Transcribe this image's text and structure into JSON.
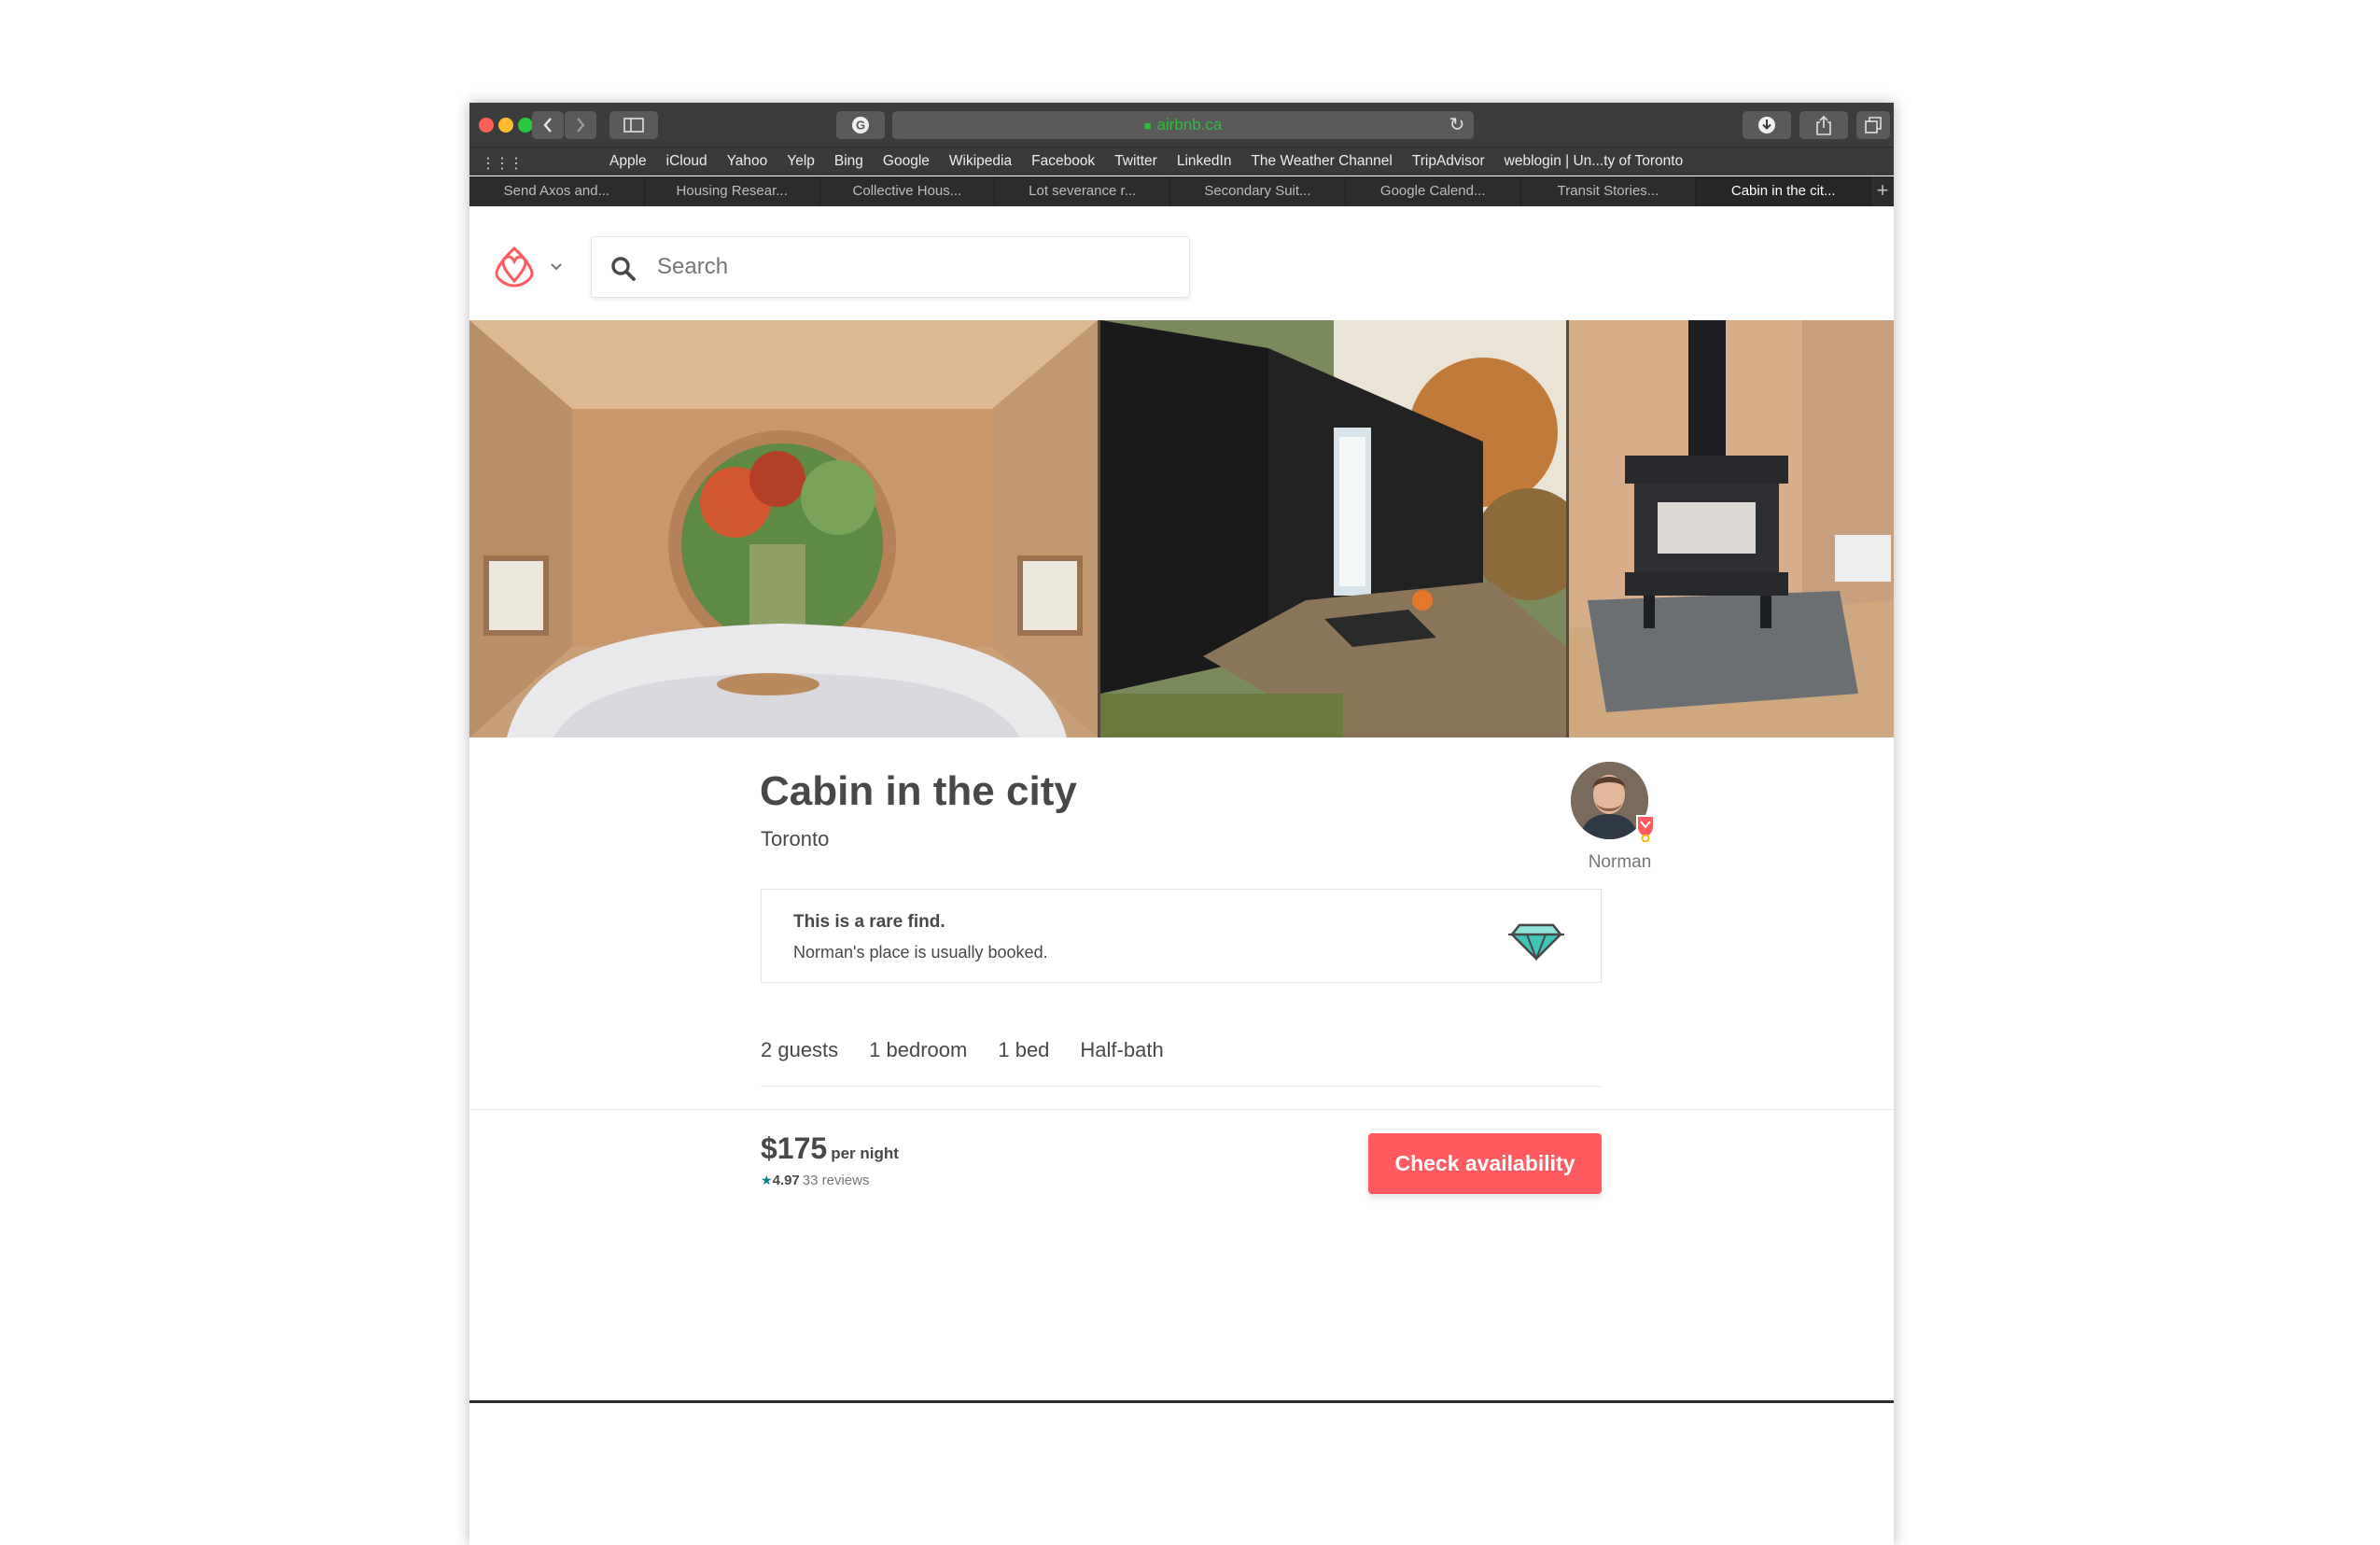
{
  "browser": {
    "url": "airbnb.ca",
    "favorites": [
      "Apple",
      "iCloud",
      "Yahoo",
      "Yelp",
      "Bing",
      "Google",
      "Wikipedia",
      "Facebook",
      "Twitter",
      "LinkedIn",
      "The Weather Channel",
      "TripAdvisor",
      "weblogin | Un...ty of Toronto"
    ],
    "tabs": [
      {
        "label": "Send Axos and..."
      },
      {
        "label": "Housing Resear..."
      },
      {
        "label": "Collective Hous..."
      },
      {
        "label": "Lot severance r..."
      },
      {
        "label": "Secondary Suit..."
      },
      {
        "label": "Google Calend..."
      },
      {
        "label": "Transit Stories..."
      },
      {
        "label": "Cabin in the cit...",
        "active": true
      }
    ],
    "icons": {
      "back": "chevron-left-icon",
      "forward": "chevron-right-icon",
      "sidebar": "sidebar-icon",
      "grammarly": "grammarly-icon",
      "lock": "lock-icon",
      "reload": "reload-icon",
      "download": "download-icon",
      "share": "share-icon",
      "tabs": "tabs-overview-icon",
      "new_tab": "plus-icon"
    }
  },
  "header": {
    "search_placeholder": "Search",
    "brand_color": "#FF5A5F"
  },
  "listing": {
    "title": "Cabin in the city",
    "location": "Toronto",
    "host_name": "Norman",
    "rare_find": {
      "title": "This is a rare find.",
      "subtitle": "Norman's place is usually booked."
    },
    "amenities": [
      "2 guests",
      "1 bedroom",
      "1 bed",
      "Half-bath"
    ]
  },
  "booking": {
    "price": "$175",
    "price_unit": "per night",
    "rating_star": "★",
    "rating": "4.97",
    "reviews": "33 reviews",
    "cta_label": "Check availability",
    "accent": "#FF5A5F",
    "rating_color": "#008489"
  }
}
